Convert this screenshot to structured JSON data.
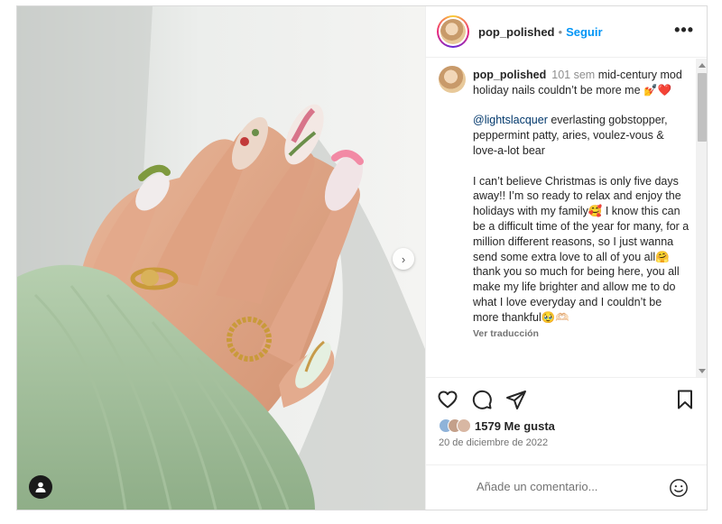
{
  "post": {
    "username": "pop_polished",
    "follow_label": "Seguir",
    "header_separator": "•",
    "more_label": "•••",
    "next_label": "›"
  },
  "caption": {
    "username": "pop_polished",
    "time_ago": "101 sem",
    "line1": "mid-century mod holiday nails couldn’t be more me 💅❤️",
    "mention": "@lightslacquer",
    "line2": " everlasting gobstopper, peppermint patty, aries, voulez-vous & love-a-lot bear",
    "line3": "I can’t believe Christmas is only five days away!! I’m so ready to relax and enjoy the holidays with my family🥰 I know this can be a difficult time of the year for many, for a million different reasons, so I just wanna send some extra love to all of you all🤗 thank you so much for being here, you all make my life brighter and allow me to do what I love everyday and I couldn’t be more thankful🥹🫶🏻",
    "translate_label": "Ver traducción"
  },
  "likes": {
    "text": "1579 Me gusta"
  },
  "date": "20 de diciembre de 2022",
  "comment_box": {
    "placeholder": "Añade un comentario..."
  },
  "icons": {
    "like": "heart-icon",
    "comment": "comment-icon",
    "share": "share-icon",
    "save": "bookmark-icon",
    "emoji": "emoji-icon",
    "tags": "user-tag-icon",
    "next": "chevron-right-icon"
  },
  "colors": {
    "link_blue": "#0095f6",
    "mention": "#00376b",
    "text": "#262626",
    "muted": "#737373",
    "border": "#dbdbdb"
  }
}
